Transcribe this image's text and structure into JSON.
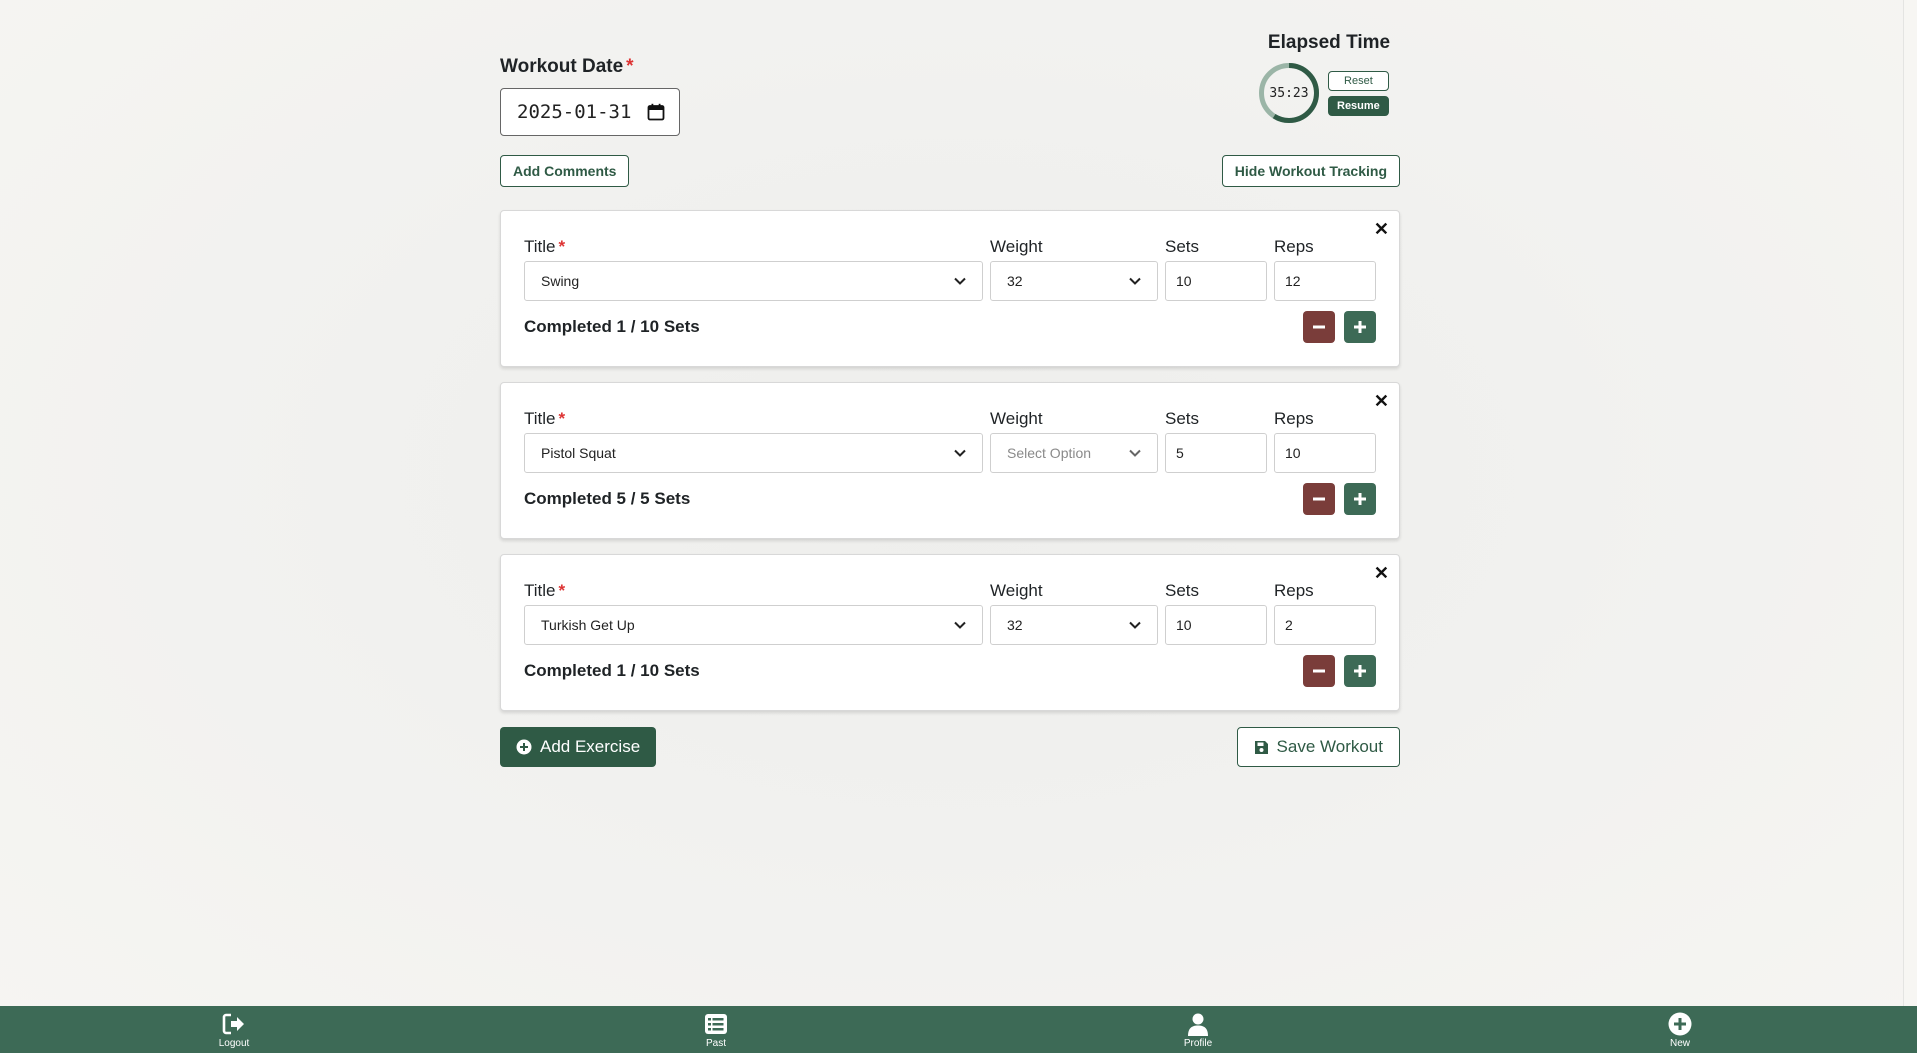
{
  "form": {
    "date_label": "Workout Date",
    "required_mark": "*",
    "date_value": "2025-01-31",
    "add_comments_label": "Add Comments",
    "hide_tracking_label": "Hide Workout Tracking"
  },
  "timer": {
    "title": "Elapsed Time",
    "time": "35:23",
    "progress_fraction": 0.59,
    "reset_label": "Reset",
    "resume_label": "Resume"
  },
  "labels": {
    "title": "Title",
    "weight": "Weight",
    "sets": "Sets",
    "reps": "Reps"
  },
  "exercises": [
    {
      "title": "Swing",
      "weight": "32",
      "weight_placeholder": false,
      "sets": "10",
      "reps": "12",
      "completed": "Completed 1 / 10 Sets"
    },
    {
      "title": "Pistol Squat",
      "weight": "Select Option",
      "weight_placeholder": true,
      "sets": "5",
      "reps": "10",
      "completed": "Completed 5 / 5 Sets"
    },
    {
      "title": "Turkish Get Up",
      "weight": "32",
      "weight_placeholder": false,
      "sets": "10",
      "reps": "2",
      "completed": "Completed 1 / 10 Sets"
    }
  ],
  "actions": {
    "add_exercise_label": "Add Exercise",
    "save_workout_label": "Save Workout"
  },
  "nav": {
    "logout": "Logout",
    "past": "Past",
    "profile": "Profile",
    "new": "New"
  },
  "colors": {
    "primary_green": "#2f5a45",
    "nav_green": "#3d6a56",
    "minus_red": "#7a3d3a",
    "required_red": "#dd3333"
  }
}
